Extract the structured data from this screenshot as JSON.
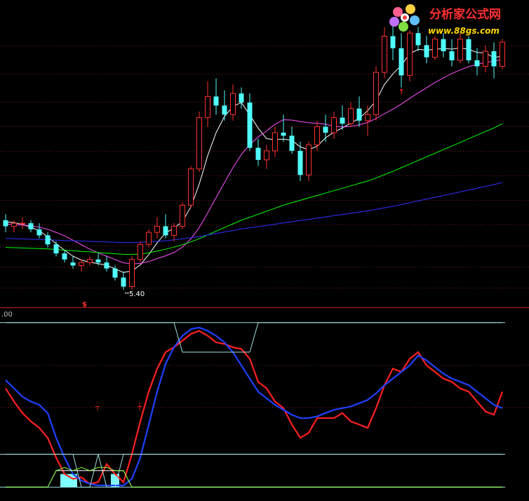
{
  "watermark": {
    "site_name": "分析家公式网",
    "site_url": "www.88gs.com",
    "colors": {
      "name": "#ff3030",
      "url": "#ffd700"
    }
  },
  "chart_data": [
    {
      "type": "candlestick",
      "panel": "main",
      "x_index_count": 60,
      "y_range": [
        5.0,
        14.3
      ],
      "grid": "dotted-horizontal",
      "annotations": [
        {
          "text": "5.40",
          "kind": "low-price",
          "index": 14,
          "value": 5.4
        },
        {
          "text": "$",
          "kind": "signal",
          "index": 9
        },
        {
          "text": "↑",
          "kind": "buy-arrow",
          "index": 47
        }
      ],
      "candles": [
        [
          7.7,
          7.9,
          7.3,
          7.5
        ],
        [
          7.5,
          7.7,
          7.3,
          7.6
        ],
        [
          7.6,
          7.8,
          7.4,
          7.6
        ],
        [
          7.6,
          7.7,
          7.3,
          7.4
        ],
        [
          7.4,
          7.6,
          7.1,
          7.2
        ],
        [
          7.2,
          7.3,
          6.8,
          6.9
        ],
        [
          6.9,
          7.0,
          6.5,
          6.6
        ],
        [
          6.6,
          6.7,
          6.3,
          6.4
        ],
        [
          6.3,
          6.5,
          6.1,
          6.2
        ],
        [
          6.2,
          6.4,
          6.0,
          6.3
        ],
        [
          6.3,
          6.5,
          6.2,
          6.4
        ],
        [
          6.4,
          6.6,
          6.2,
          6.3
        ],
        [
          6.3,
          6.5,
          6.0,
          6.1
        ],
        [
          6.1,
          6.2,
          5.7,
          5.8
        ],
        [
          5.8,
          6.0,
          5.4,
          5.5
        ],
        [
          5.5,
          6.5,
          5.4,
          6.4
        ],
        [
          6.4,
          7.0,
          6.3,
          6.9
        ],
        [
          6.9,
          7.4,
          6.8,
          7.3
        ],
        [
          7.3,
          7.8,
          7.1,
          7.5
        ],
        [
          7.5,
          7.9,
          7.1,
          7.2
        ],
        [
          7.2,
          7.6,
          7.0,
          7.5
        ],
        [
          7.5,
          8.3,
          7.4,
          8.2
        ],
        [
          8.2,
          9.5,
          8.1,
          9.4
        ],
        [
          9.4,
          11.3,
          9.3,
          11.1
        ],
        [
          11.1,
          12.3,
          10.8,
          11.8
        ],
        [
          11.8,
          12.4,
          11.2,
          11.5
        ],
        [
          11.5,
          12.0,
          11.0,
          11.2
        ],
        [
          11.2,
          12.2,
          11.0,
          11.9
        ],
        [
          11.9,
          12.1,
          11.4,
          11.6
        ],
        [
          11.6,
          11.9,
          10.0,
          10.1
        ],
        [
          10.1,
          10.4,
          9.5,
          9.7
        ],
        [
          9.7,
          10.2,
          9.4,
          10.0
        ],
        [
          10.0,
          10.8,
          9.8,
          10.6
        ],
        [
          10.6,
          11.2,
          10.3,
          10.5
        ],
        [
          10.5,
          10.8,
          9.9,
          10.0
        ],
        [
          10.0,
          10.3,
          9.0,
          9.2
        ],
        [
          9.2,
          10.3,
          9.0,
          10.2
        ],
        [
          10.2,
          11.0,
          10.0,
          10.8
        ],
        [
          10.8,
          11.2,
          10.3,
          10.6
        ],
        [
          10.6,
          11.3,
          10.4,
          11.1
        ],
        [
          11.1,
          11.5,
          10.7,
          10.9
        ],
        [
          10.9,
          11.6,
          10.8,
          11.4
        ],
        [
          11.4,
          11.8,
          10.8,
          11.0
        ],
        [
          11.0,
          11.5,
          10.5,
          11.2
        ],
        [
          11.2,
          12.8,
          11.0,
          12.6
        ],
        [
          12.6,
          14.1,
          12.4,
          13.8
        ],
        [
          13.8,
          14.2,
          13.0,
          13.4
        ],
        [
          13.4,
          13.9,
          12.1,
          12.5
        ],
        [
          12.5,
          14.0,
          12.3,
          13.9
        ],
        [
          13.9,
          14.1,
          13.3,
          13.5
        ],
        [
          13.5,
          13.8,
          12.9,
          13.1
        ],
        [
          13.1,
          13.8,
          13.0,
          13.7
        ],
        [
          13.7,
          13.9,
          13.1,
          13.3
        ],
        [
          13.3,
          13.7,
          12.8,
          13.0
        ],
        [
          13.0,
          13.9,
          12.9,
          13.7
        ],
        [
          13.7,
          13.8,
          12.9,
          13.0
        ],
        [
          13.0,
          13.4,
          12.5,
          12.8
        ],
        [
          12.8,
          13.5,
          12.6,
          13.3
        ],
        [
          13.3,
          13.6,
          12.4,
          12.8
        ],
        [
          12.8,
          13.7,
          12.7,
          13.6
        ]
      ],
      "candle_fields": [
        "open",
        "high",
        "low",
        "close"
      ],
      "series": [
        {
          "kind": "moving-average",
          "color": "#ffffff",
          "values": [
            7.65,
            7.62,
            7.56,
            7.47,
            7.35,
            7.15,
            6.92,
            6.71,
            6.51,
            6.38,
            6.31,
            6.26,
            6.21,
            6.09,
            5.97,
            6.02,
            6.22,
            6.56,
            6.95,
            7.28,
            7.44,
            7.66,
            8.14,
            8.9,
            9.84,
            10.6,
            11.14,
            11.47,
            11.6,
            11.19,
            10.75,
            10.4,
            10.37,
            10.39,
            10.35,
            10.13,
            10.04,
            10.15,
            10.43,
            10.62,
            10.76,
            10.92,
            11.08,
            11.33,
            11.66,
            12.2,
            12.55,
            12.83,
            13.22,
            13.36,
            13.34,
            13.36,
            13.39,
            13.37,
            13.41,
            13.36,
            13.26,
            13.25,
            13.08,
            13.15
          ]
        },
        {
          "kind": "moving-average",
          "color": "#ff50ff",
          "values": [
            7.58,
            7.56,
            7.54,
            7.51,
            7.47,
            7.4,
            7.3,
            7.18,
            7.04,
            6.89,
            6.74,
            6.62,
            6.51,
            6.4,
            6.29,
            6.25,
            6.27,
            6.33,
            6.43,
            6.52,
            6.63,
            6.81,
            7.08,
            7.46,
            7.94,
            8.45,
            8.95,
            9.44,
            9.88,
            10.21,
            10.46,
            10.66,
            10.88,
            11.03,
            11.02,
            10.97,
            10.93,
            10.91,
            10.88,
            10.82,
            10.79,
            10.81,
            10.86,
            10.94,
            11.07,
            11.23,
            11.38,
            11.55,
            11.74,
            11.92,
            12.09,
            12.26,
            12.42,
            12.56,
            12.68,
            12.79,
            12.86,
            12.93,
            12.97,
            13.03
          ]
        },
        {
          "kind": "moving-average",
          "color": "#00ff00",
          "values": [
            6.8,
            6.79,
            6.78,
            6.77,
            6.76,
            6.75,
            6.73,
            6.71,
            6.69,
            6.67,
            6.65,
            6.63,
            6.61,
            6.59,
            6.57,
            6.57,
            6.58,
            6.62,
            6.68,
            6.74,
            6.81,
            6.89,
            6.98,
            7.09,
            7.21,
            7.34,
            7.46,
            7.58,
            7.7,
            7.8,
            7.9,
            8.0,
            8.1,
            8.2,
            8.28,
            8.36,
            8.44,
            8.52,
            8.6,
            8.68,
            8.76,
            8.84,
            8.92,
            9.0,
            9.1,
            9.21,
            9.32,
            9.44,
            9.56,
            9.68,
            9.8,
            9.92,
            10.04,
            10.16,
            10.28,
            10.4,
            10.52,
            10.64,
            10.76,
            10.9
          ]
        },
        {
          "kind": "moving-average",
          "color": "#3030ff",
          "values": [
            7.1,
            7.09,
            7.08,
            7.07,
            7.06,
            7.05,
            7.04,
            7.03,
            7.02,
            7.01,
            7.0,
            6.99,
            6.98,
            6.97,
            6.96,
            6.96,
            6.97,
            6.98,
            7.0,
            7.02,
            7.05,
            7.08,
            7.12,
            7.16,
            7.21,
            7.26,
            7.31,
            7.36,
            7.41,
            7.45,
            7.49,
            7.53,
            7.57,
            7.61,
            7.65,
            7.69,
            7.73,
            7.77,
            7.81,
            7.85,
            7.89,
            7.93,
            7.97,
            8.01,
            8.06,
            8.11,
            8.16,
            8.22,
            8.28,
            8.34,
            8.4,
            8.46,
            8.52,
            8.58,
            8.64,
            8.7,
            8.76,
            8.82,
            8.88,
            8.95
          ]
        }
      ]
    },
    {
      "type": "line",
      "panel": "indicator",
      "title": ".00",
      "y_range": [
        -5,
        105
      ],
      "reference_levels": [
        0,
        20,
        100
      ],
      "signals": [
        {
          "text": "┬",
          "index": 11,
          "color": "#ff2020"
        },
        {
          "text": "┼",
          "index": 16,
          "color": "#ff2020"
        }
      ],
      "series": [
        {
          "kind": "indicator",
          "color": "#ff2020",
          "values": [
            60,
            52,
            45,
            40,
            36,
            30,
            18,
            8,
            5,
            6,
            2,
            3,
            14,
            8,
            3,
            20,
            40,
            58,
            72,
            82,
            85,
            89,
            93,
            95,
            92,
            88,
            87,
            85,
            84,
            78,
            64,
            60,
            52,
            48,
            38,
            30,
            33,
            42,
            42,
            42,
            45,
            40,
            38,
            36,
            48,
            62,
            72,
            70,
            78,
            82,
            74,
            70,
            66,
            64,
            60,
            58,
            52,
            46,
            44,
            58
          ]
        },
        {
          "kind": "indicator",
          "color": "#2040ff",
          "values": [
            65,
            60,
            55,
            52,
            50,
            45,
            30,
            18,
            8,
            4,
            2,
            1,
            1,
            1,
            1,
            5,
            18,
            38,
            58,
            75,
            85,
            92,
            96,
            97,
            95,
            92,
            88,
            82,
            74,
            66,
            58,
            54,
            50,
            47,
            44,
            42,
            42,
            43,
            45,
            47,
            48,
            49,
            51,
            53,
            57,
            62,
            66,
            70,
            74,
            80,
            77,
            73,
            69,
            66,
            64,
            62,
            58,
            54,
            50,
            48
          ]
        },
        {
          "kind": "step-band",
          "color": "#a0e0e0",
          "values": [
            100,
            100,
            100,
            100,
            100,
            100,
            100,
            100,
            100,
            100,
            100,
            100,
            100,
            100,
            100,
            100,
            100,
            100,
            100,
            100,
            100,
            82,
            82,
            82,
            82,
            82,
            82,
            82,
            82,
            82,
            100,
            100,
            100,
            100,
            100,
            100,
            100,
            100,
            100,
            100,
            100,
            100,
            100,
            100,
            100,
            100,
            100,
            100,
            100,
            100,
            100,
            100,
            100,
            100,
            100,
            100,
            100,
            100,
            100,
            100
          ]
        },
        {
          "kind": "triangle-band",
          "color": "#a0e0e0",
          "values": [
            20,
            20,
            20,
            20,
            20,
            20,
            20,
            20,
            20,
            0,
            0,
            20,
            0,
            0,
            20,
            20,
            20,
            20,
            20,
            20,
            20,
            20,
            20,
            20,
            20,
            20,
            20,
            20,
            20,
            20,
            20,
            20,
            20,
            20,
            20,
            20,
            20,
            20,
            20,
            20,
            20,
            20,
            20,
            20,
            20,
            20,
            20,
            20,
            20,
            20,
            20,
            20,
            20,
            20,
            20,
            20,
            20,
            20,
            20,
            20
          ]
        },
        {
          "kind": "bottom-frame",
          "color": "#ffffff",
          "values": [
            0,
            0,
            0,
            0,
            0,
            0,
            10,
            10,
            10,
            10,
            10,
            10,
            10,
            10,
            10,
            0,
            0,
            0,
            0,
            0,
            0,
            0,
            0,
            0,
            0,
            0,
            0,
            0,
            0,
            0,
            0,
            0,
            0,
            0,
            0,
            0,
            0,
            0,
            0,
            0,
            0,
            0,
            0,
            0,
            0,
            0,
            0,
            0,
            0,
            0,
            0,
            0,
            0,
            0,
            0,
            0,
            0,
            0,
            0,
            0
          ]
        },
        {
          "kind": "green-frame",
          "color": "#80ff40",
          "values": [
            0,
            0,
            0,
            0,
            0,
            0,
            10,
            12,
            10,
            12,
            10,
            12,
            12,
            10,
            10,
            0,
            0,
            0,
            0,
            0,
            0,
            0,
            0,
            0,
            0,
            0,
            0,
            0,
            0,
            0,
            0,
            0,
            0,
            0,
            0,
            0,
            0,
            0,
            0,
            0,
            0,
            0,
            0,
            0,
            0,
            0,
            0,
            0,
            0,
            0,
            0,
            0,
            0,
            0,
            0,
            0,
            0,
            0,
            0,
            0
          ]
        }
      ],
      "filled_bars": {
        "color": "#80ffff",
        "indices": [
          7,
          8,
          13
        ]
      }
    }
  ]
}
